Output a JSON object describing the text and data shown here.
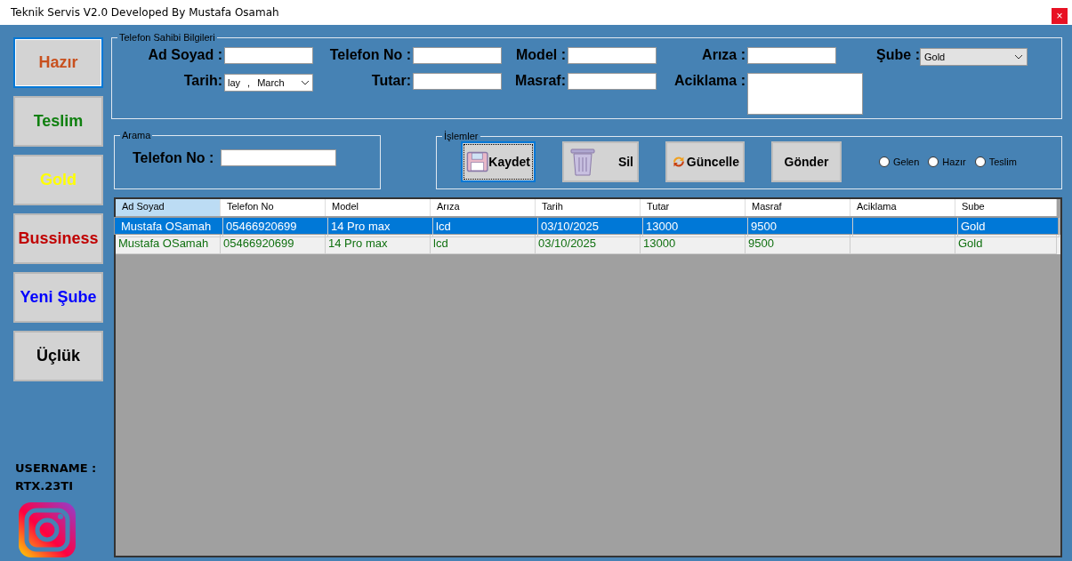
{
  "window": {
    "title": "Teknik Servis V2.0 Developed By Mustafa Osamah",
    "close": "×"
  },
  "sidebar": {
    "items": [
      {
        "label": "Hazır",
        "color": "#c8501e",
        "focused": true
      },
      {
        "label": "Teslim",
        "color": "#108010",
        "focused": false
      },
      {
        "label": "Gold",
        "color": "#ffff00",
        "focused": false
      },
      {
        "label": "Bussiness",
        "color": "#c00000",
        "focused": false
      },
      {
        "label": "Yeni Şube",
        "color": "#0000ff",
        "focused": false
      },
      {
        "label": "Üçlük",
        "color": "#000000",
        "focused": false
      }
    ],
    "username_label": "USERNAME :",
    "username": "RTX.23TI"
  },
  "owner_info": {
    "title": "Telefon Sahibi Bilgileri",
    "fields": [
      {
        "label": "Ad Soyad :",
        "kind": "text"
      },
      {
        "label": "Telefon No :",
        "kind": "text"
      },
      {
        "label": "Model :",
        "kind": "text"
      },
      {
        "label": "Arıza :",
        "kind": "text"
      },
      {
        "label": "Şube :",
        "kind": "select",
        "value": "Gold"
      },
      {
        "label": "Tarih:",
        "kind": "date",
        "value_day": "lay",
        "value_sep": ",",
        "value_month": "March"
      },
      {
        "label": "Tutar:",
        "kind": "text"
      },
      {
        "label": "Masraf:",
        "kind": "text"
      },
      {
        "label": "Aciklama :",
        "kind": "textarea"
      }
    ]
  },
  "search": {
    "title": "Arama",
    "label": "Telefon No :"
  },
  "actions": {
    "title": "İşlemler",
    "buttons": [
      {
        "label": "Kaydet",
        "focused": true
      },
      {
        "label": "Sil",
        "focused": false
      },
      {
        "label": "Güncelle",
        "focused": false
      },
      {
        "label": "Gönder",
        "focused": false
      }
    ],
    "radios": [
      {
        "label": "Gelen",
        "selected": false
      },
      {
        "label": "Hazır",
        "selected": false
      },
      {
        "label": "Teslim",
        "selected": false
      }
    ]
  },
  "table": {
    "columns": [
      {
        "label": "Ad Soyad",
        "selected": true
      },
      {
        "label": "Telefon No",
        "selected": false
      },
      {
        "label": "Model",
        "selected": false
      },
      {
        "label": "Arıza",
        "selected": false
      },
      {
        "label": "Tarih",
        "selected": false
      },
      {
        "label": "Tutar",
        "selected": false
      },
      {
        "label": "Masraf",
        "selected": false
      },
      {
        "label": "Aciklama",
        "selected": false
      },
      {
        "label": "Sube",
        "selected": false
      }
    ],
    "rows": [
      {
        "selected": true,
        "cells": [
          "Mustafa OSamah",
          "05466920699",
          "14 Pro max",
          "lcd",
          "03/10/2025",
          "13000",
          "9500",
          "",
          "Gold"
        ]
      },
      {
        "selected": false,
        "cells": [
          "Mustafa OSamah",
          "05466920699",
          "14 Pro max",
          "lcd",
          "03/10/2025",
          "13000",
          "9500",
          "",
          "Gold"
        ]
      }
    ]
  }
}
